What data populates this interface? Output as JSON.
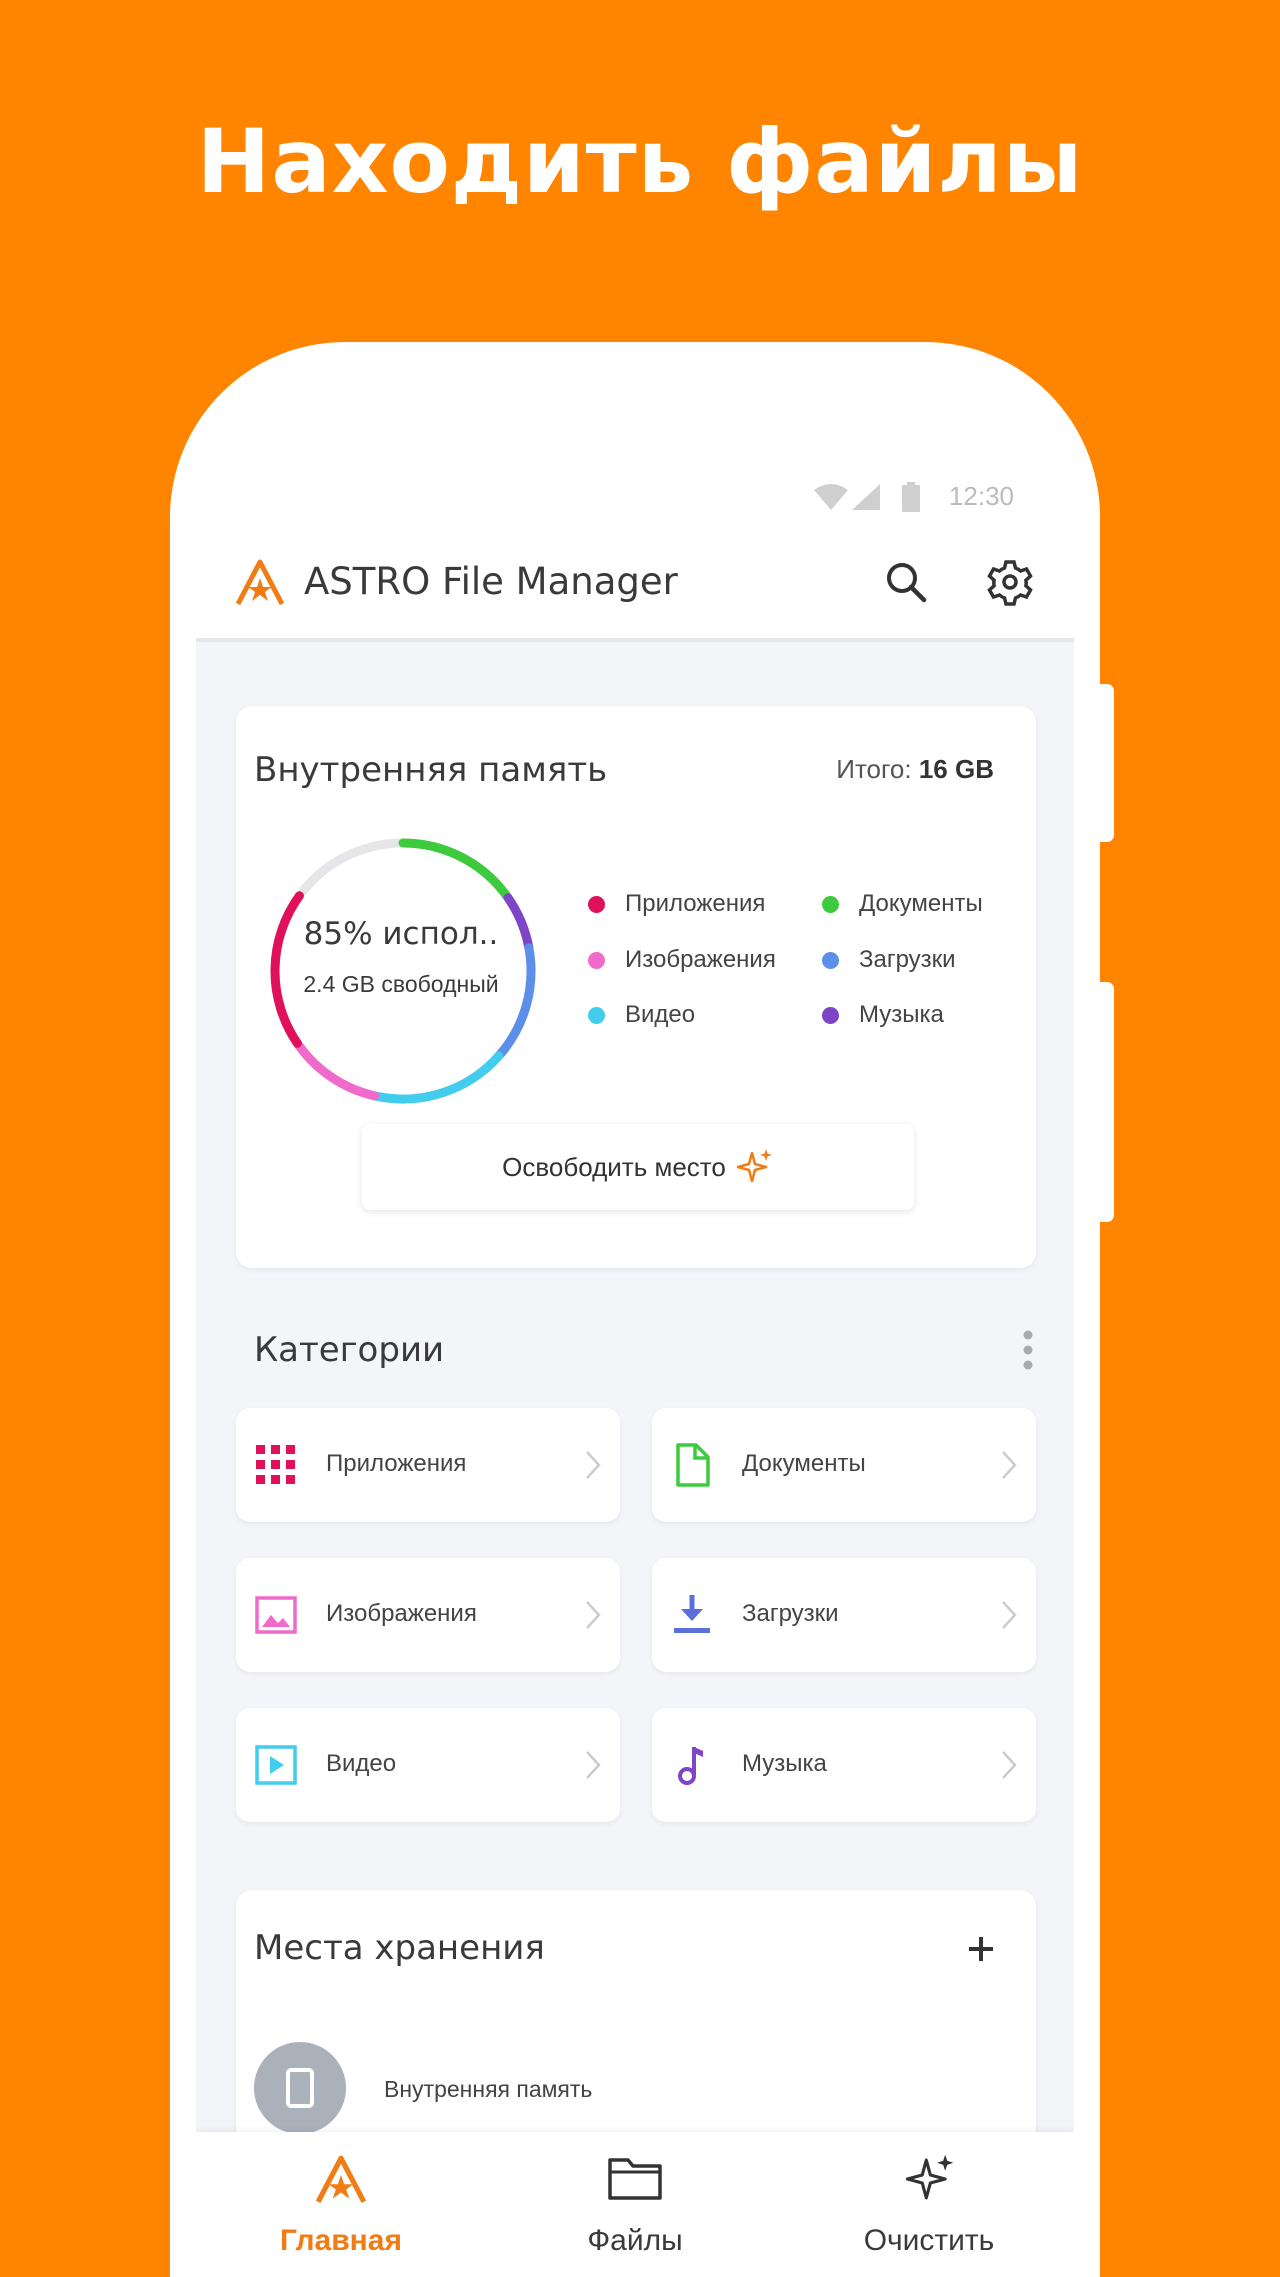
{
  "headline": "Находить файлы",
  "status_bar": {
    "time": "12:30"
  },
  "app_bar": {
    "title": "ASTRO File Manager"
  },
  "storage": {
    "title": "Внутренняя память",
    "total_label": "Итого:",
    "total_value": "16 GB",
    "used_text": "85% испол..",
    "free_text": "2.4 GB свободный",
    "used_percent": 85,
    "legend": [
      {
        "label": "Приложения",
        "color": "#E0105A"
      },
      {
        "label": "Документы",
        "color": "#3DCB3D"
      },
      {
        "label": "Изображения",
        "color": "#F06ACB"
      },
      {
        "label": "Загрузки",
        "color": "#5B8FE9"
      },
      {
        "label": "Видео",
        "color": "#42CCEE"
      },
      {
        "label": "Музыка",
        "color": "#7E45C8"
      }
    ],
    "free_button": "Освободить место"
  },
  "categories": {
    "title": "Категории",
    "items": [
      {
        "label": "Приложения",
        "icon": "apps-grid-icon",
        "color": "#E0105A"
      },
      {
        "label": "Документы",
        "icon": "document-icon",
        "color": "#3DCB3D"
      },
      {
        "label": "Изображения",
        "icon": "image-icon",
        "color": "#F06ACB"
      },
      {
        "label": "Загрузки",
        "icon": "download-icon",
        "color": "#5B70D9"
      },
      {
        "label": "Видео",
        "icon": "video-icon",
        "color": "#42CCEE"
      },
      {
        "label": "Музыка",
        "icon": "music-note-icon",
        "color": "#7E45C8"
      }
    ]
  },
  "places": {
    "title": "Места хранения",
    "items": [
      {
        "label": "Внутренняя память",
        "icon": "phone-icon"
      }
    ]
  },
  "bottom_nav": {
    "items": [
      {
        "label": "Главная",
        "icon": "astro-logo-icon",
        "active": true
      },
      {
        "label": "Файлы",
        "icon": "folder-icon",
        "active": false
      },
      {
        "label": "Очистить",
        "icon": "sparkle-icon",
        "active": false
      }
    ]
  },
  "colors": {
    "brand_orange": "#FF8400",
    "accent": "#F07C16"
  }
}
